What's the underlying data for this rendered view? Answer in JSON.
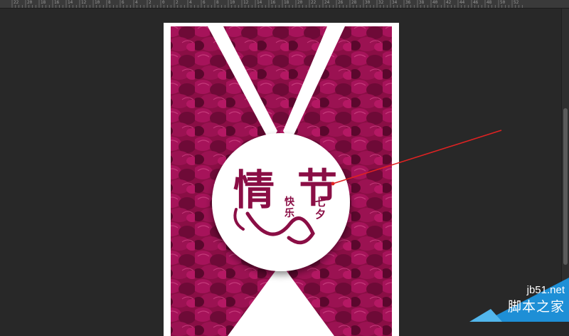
{
  "ruler": {
    "ticks": [
      "22",
      "20",
      "18",
      "16",
      "14",
      "12",
      "10",
      "8",
      "6",
      "4",
      "2",
      "0",
      "2",
      "4",
      "6",
      "8",
      "10",
      "12",
      "14",
      "16",
      "18",
      "20",
      "22",
      "24",
      "26",
      "28",
      "30",
      "32",
      "34",
      "36",
      "38",
      "40",
      "42",
      "44",
      "46",
      "48",
      "50",
      "52"
    ]
  },
  "poster": {
    "title_left": "情",
    "title_right": "节",
    "sub_left": "快乐",
    "sub_right": "七夕",
    "colors": {
      "petal": "#8a0e45",
      "petal_dark": "#4a0524",
      "white": "#ffffff"
    }
  },
  "watermark": {
    "site": "jb51.net",
    "name": "脚本之家",
    "color": "#1e8fd6"
  }
}
